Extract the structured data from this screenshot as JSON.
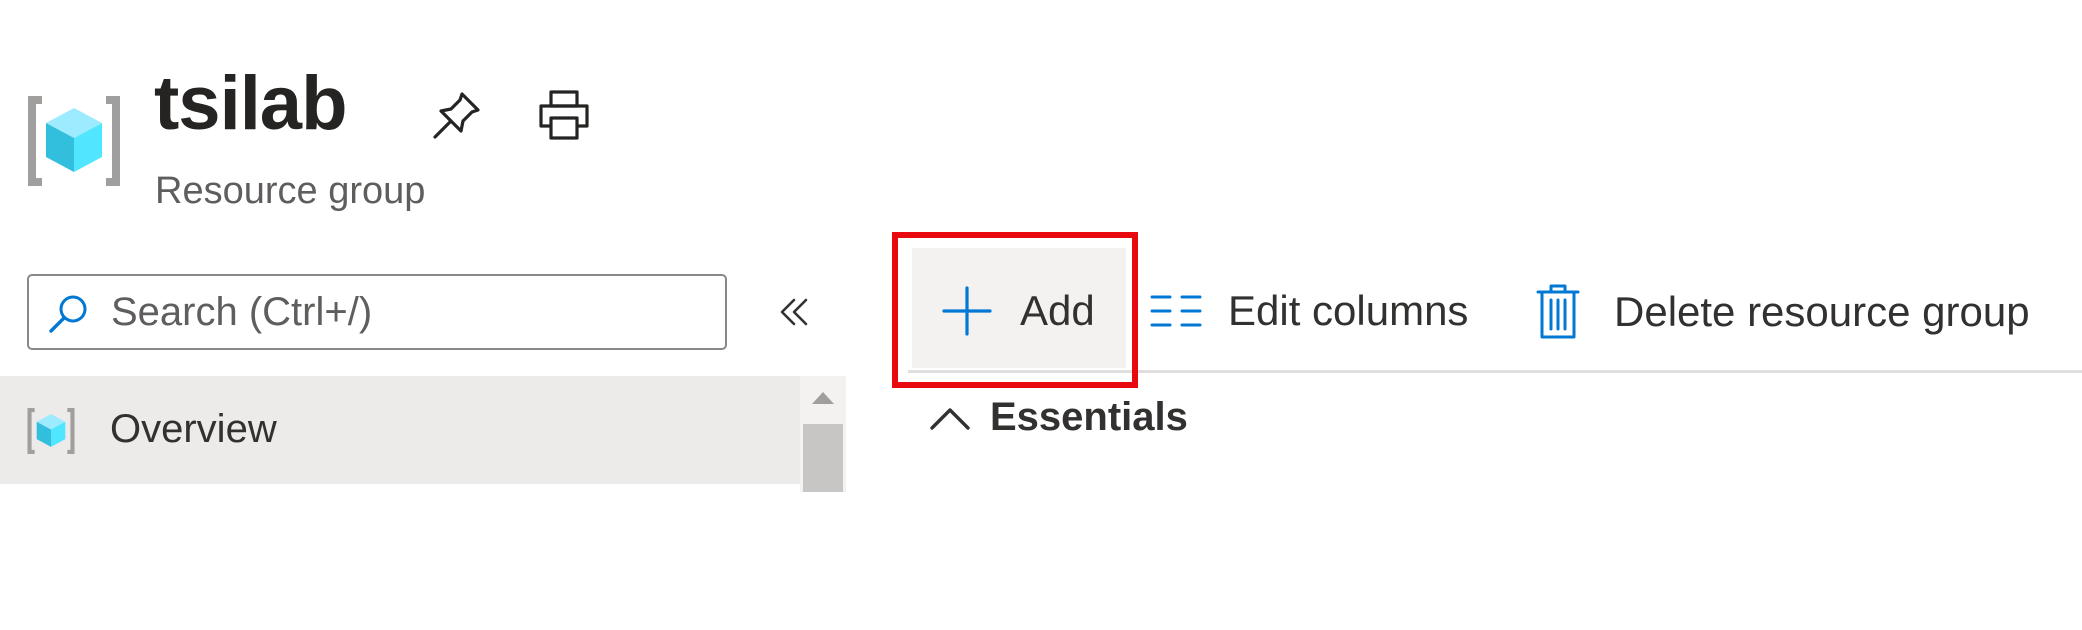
{
  "header": {
    "title": "tsilab",
    "subtitle": "Resource group",
    "icons": {
      "resource": "resource-group-icon",
      "pin": "pin-icon",
      "print": "print-icon"
    }
  },
  "sidebar": {
    "search": {
      "placeholder": "Search (Ctrl+/)",
      "value": "",
      "icon": "search-icon"
    },
    "collapse_icon": "double-chevron-left-icon",
    "items": [
      {
        "label": "Overview",
        "icon": "resource-group-icon",
        "selected": true
      }
    ]
  },
  "toolbar": {
    "add_label": "Add",
    "edit_columns_label": "Edit columns",
    "delete_label": "Delete resource group",
    "highlighted": "Add"
  },
  "essentials": {
    "label": "Essentials",
    "expanded": true
  },
  "colors": {
    "accent": "#0078d4",
    "highlight": "#e8080f",
    "selected_bg": "#edebe9",
    "cube_light": "#50e6ff",
    "cube_dark": "#32bedd",
    "bracket": "#a19f9d"
  }
}
